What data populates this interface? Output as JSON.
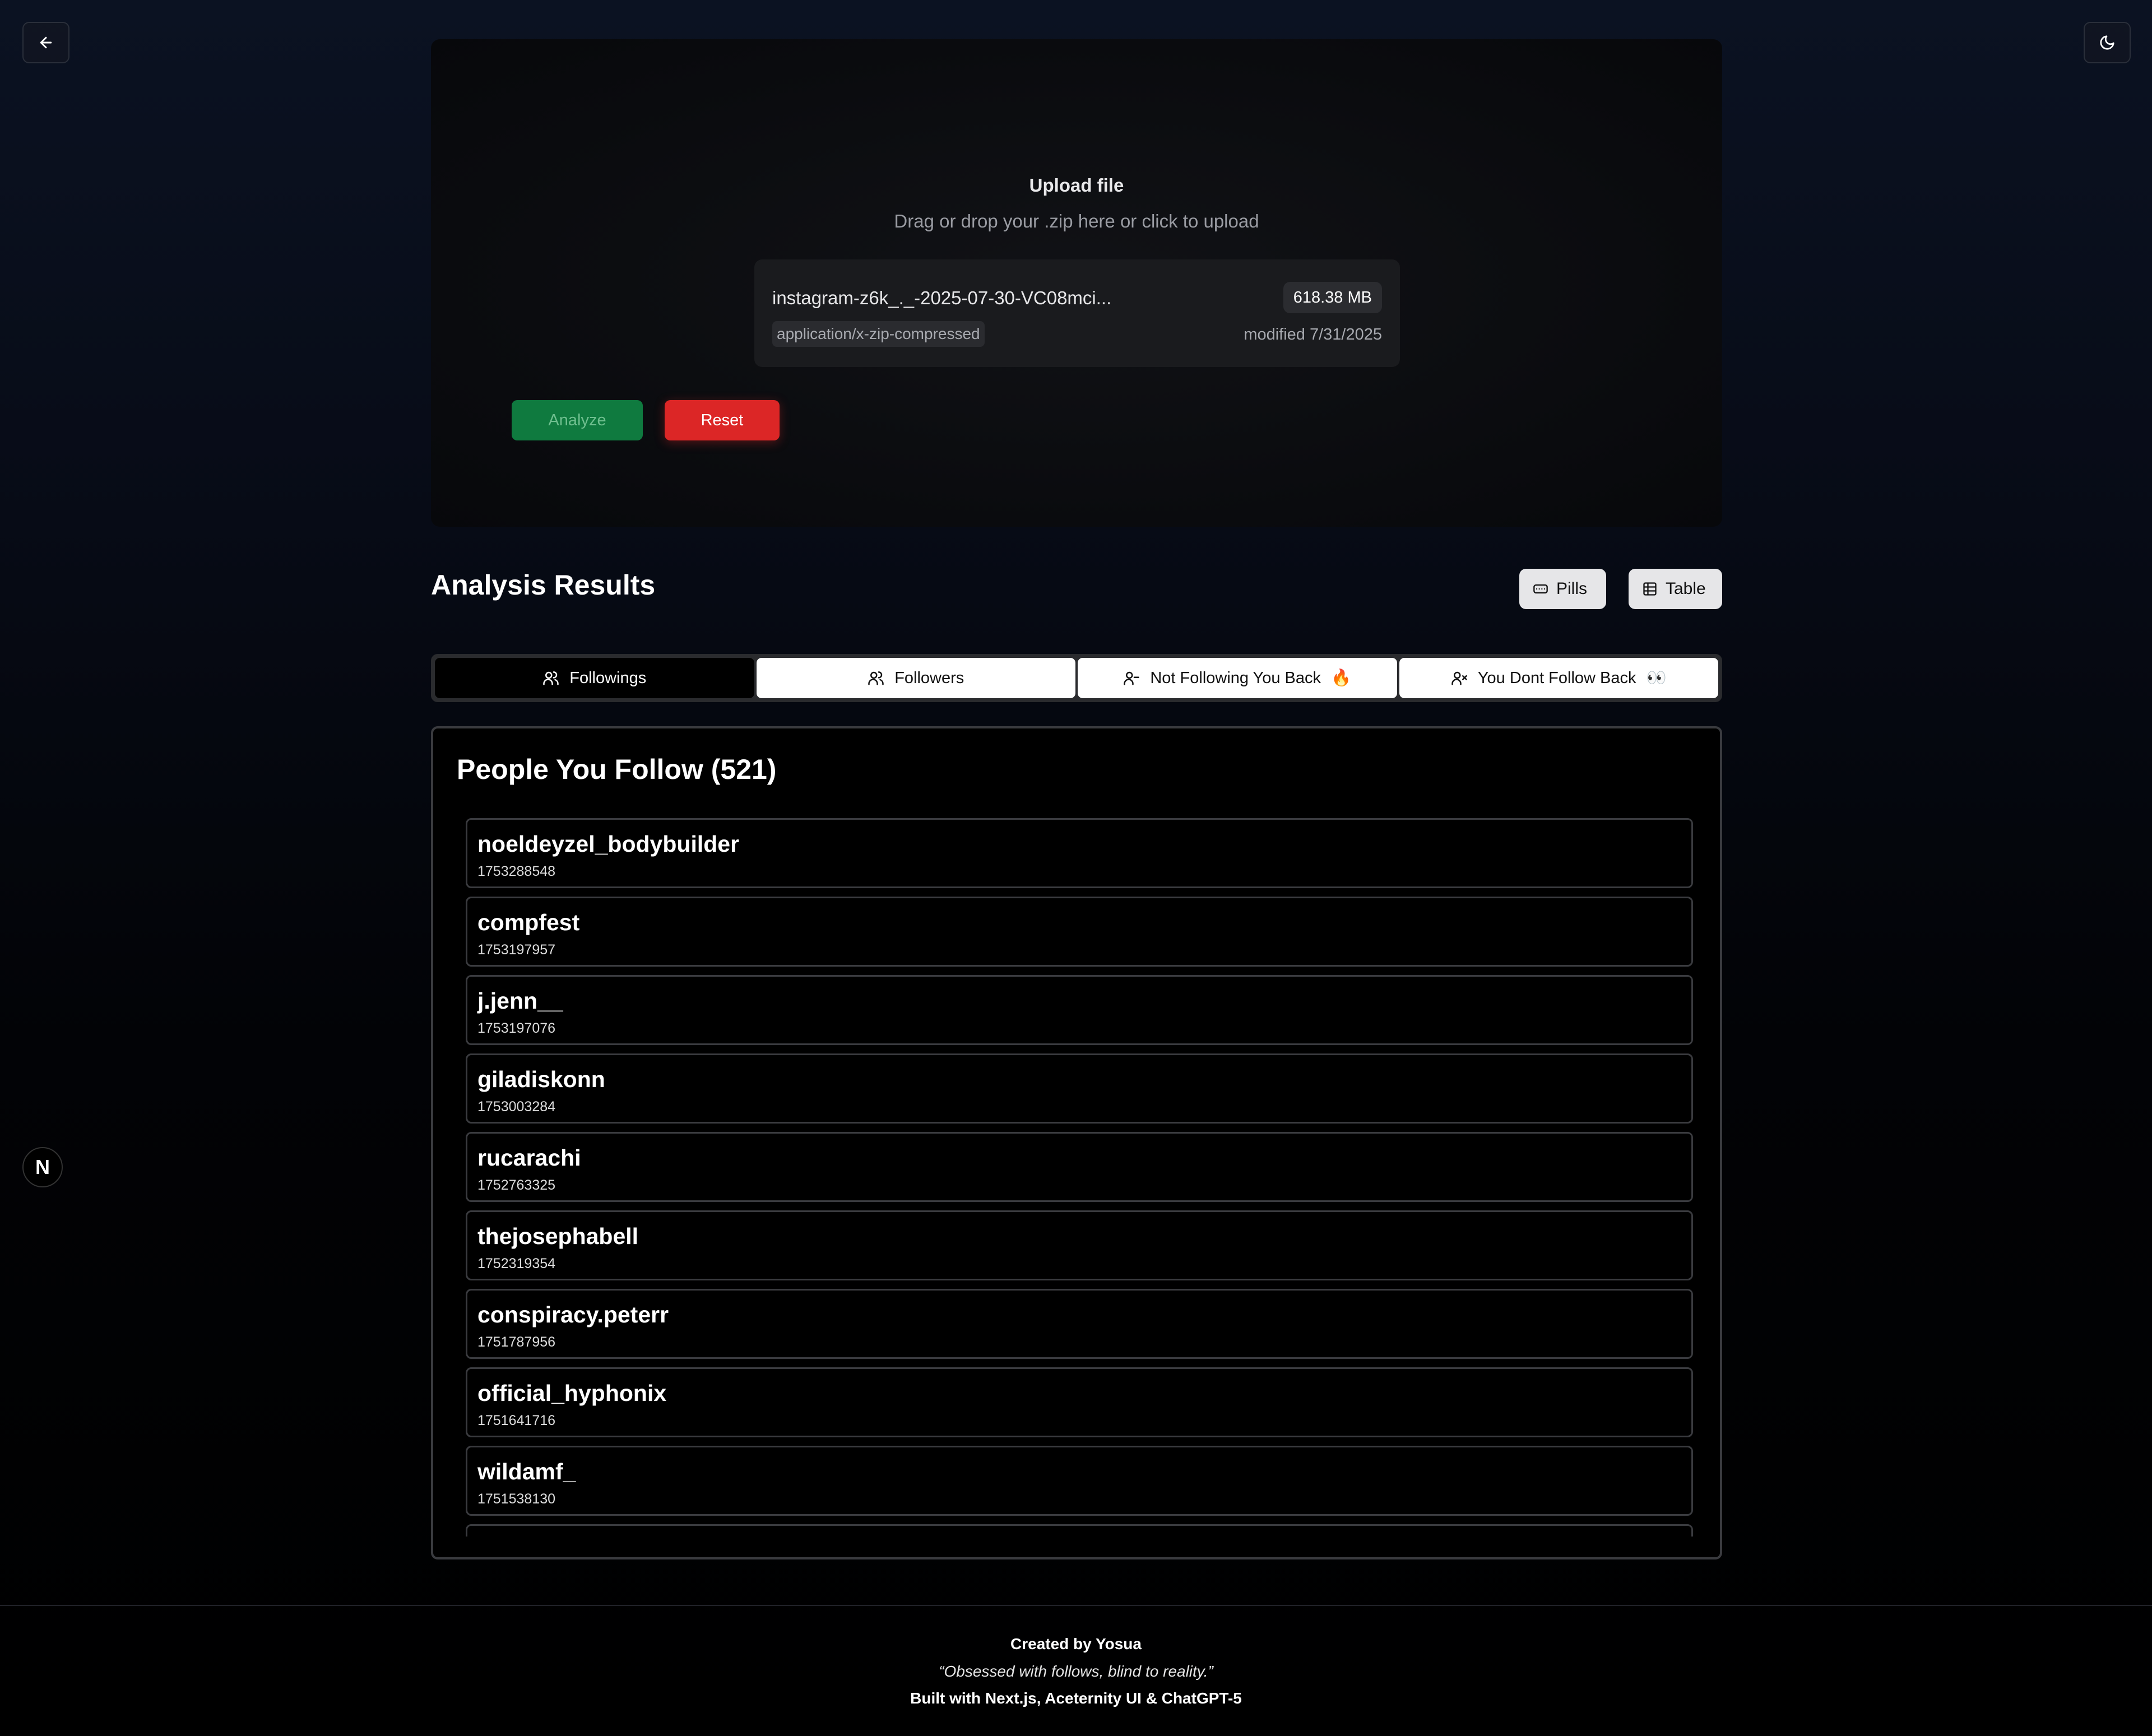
{
  "upload": {
    "title": "Upload file",
    "subtitle": "Drag or drop your .zip here or click to upload",
    "file": {
      "name": "instagram-z6k_._-2025-07-30-VC08mci...",
      "size": "618.38 MB",
      "type": "application/x-zip-compressed",
      "modified": "modified 7/31/2025"
    },
    "analyze_label": "Analyze",
    "reset_label": "Reset"
  },
  "results": {
    "title": "Analysis Results",
    "pills_label": "Pills",
    "table_label": "Table"
  },
  "tabs": [
    {
      "label": "Followings"
    },
    {
      "label": "Followers"
    },
    {
      "label": "Not Following You Back",
      "emoji": "🔥"
    },
    {
      "label": "You Dont Follow Back",
      "emoji": "👀"
    }
  ],
  "panel": {
    "title": "People You Follow (521)",
    "items": [
      {
        "name": "noeldeyzel_bodybuilder",
        "id": "1753288548"
      },
      {
        "name": "compfest",
        "id": "1753197957"
      },
      {
        "name": "j.jenn__",
        "id": "1753197076"
      },
      {
        "name": "giladiskonn",
        "id": "1753003284"
      },
      {
        "name": "rucarachi",
        "id": "1752763325"
      },
      {
        "name": "thejosephabell",
        "id": "1752319354"
      },
      {
        "name": "conspiracy.peterr",
        "id": "1751787956"
      },
      {
        "name": "official_hyphonix",
        "id": "1751641716"
      },
      {
        "name": "wildamf_",
        "id": "1751538130"
      },
      {
        "name": "",
        "id": ""
      }
    ]
  },
  "badge": {
    "letter": "N"
  },
  "footer": {
    "created": "Created by Yosua",
    "quote": "“Obsessed with follows, blind to reality.”",
    "built": "Built with Next.js, Aceternity UI & ChatGPT-5"
  },
  "colors": {
    "analyze": "#0f7a3f",
    "reset": "#dc2626"
  }
}
